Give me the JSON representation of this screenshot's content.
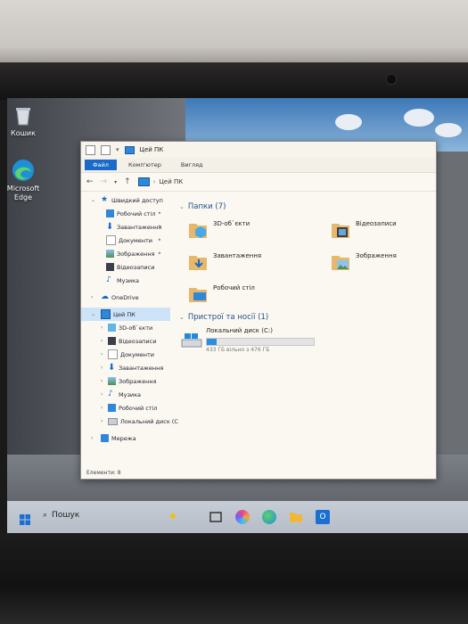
{
  "desktop": {
    "icons": [
      {
        "label": "Кошик",
        "icon": "recycle-bin-icon"
      },
      {
        "label": "Microsoft Edge",
        "icon": "edge-icon"
      }
    ]
  },
  "window": {
    "title": "Цей ПК",
    "ribbon_tabs": [
      "Файл",
      "Комп'ютер",
      "Вигляд"
    ],
    "address_path": "Цей ПК",
    "status_text": "Елементи: 8"
  },
  "nav": {
    "quick_access": "Швидкий доступ",
    "quick_items": [
      {
        "label": "Робочий стіл",
        "pinned": true
      },
      {
        "label": "Завантаження",
        "pinned": true
      },
      {
        "label": "Документи",
        "pinned": true
      },
      {
        "label": "Зображення",
        "pinned": true
      },
      {
        "label": "Відеозаписи",
        "pinned": false
      },
      {
        "label": "Музика",
        "pinned": false
      }
    ],
    "onedrive": "OneDrive",
    "this_pc": "Цей ПК",
    "pc_items": [
      "3D-об`єкти",
      "Відеозаписи",
      "Документи",
      "Завантаження",
      "Зображення",
      "Музика",
      "Робочий стіл",
      "Локальний диск (C"
    ],
    "network": "Мережа"
  },
  "content": {
    "folders_header": "Папки (7)",
    "folders": [
      {
        "label": "3D-об`єкти"
      },
      {
        "label": "Відеозаписи"
      },
      {
        "label": "Завантаження"
      },
      {
        "label": "Зображення"
      },
      {
        "label": "Робочий стіл"
      }
    ],
    "devices_header": "Пристрої та носії (1)",
    "drive": {
      "name": "Локальний диск (C:)",
      "free_text": "433 ГБ вільно з 476 ГБ",
      "used_fraction": 0.09
    }
  },
  "taskbar": {
    "search_label": "Пошук",
    "icons": [
      "windows-start-icon",
      "search-icon",
      "copilot-icon",
      "task-view-icon",
      "copilot-app-icon",
      "edge-icon",
      "file-explorer-icon",
      "outlook-icon"
    ]
  },
  "colors": {
    "accent": "#1b69c9",
    "selection": "#cde3f7",
    "folder": "#e8b86a"
  }
}
